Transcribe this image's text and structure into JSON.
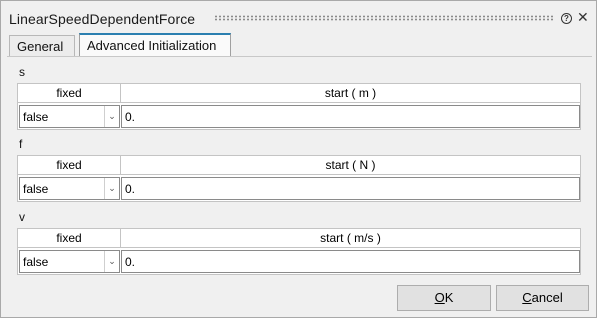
{
  "window": {
    "title": "LinearSpeedDependentForce",
    "help_glyph": "?",
    "close_glyph": "✕"
  },
  "tabs": [
    {
      "label": "General",
      "active": false
    },
    {
      "label": "Advanced Initialization",
      "active": true
    }
  ],
  "sections": [
    {
      "label": "s",
      "fixed_header": "fixed",
      "start_header": "start ( m )",
      "fixed_value": "false",
      "start_value": "0."
    },
    {
      "label": "f",
      "fixed_header": "fixed",
      "start_header": "start ( N )",
      "fixed_value": "false",
      "start_value": "0."
    },
    {
      "label": "v",
      "fixed_header": "fixed",
      "start_header": "start ( m/s )",
      "fixed_value": "false",
      "start_value": "0."
    }
  ],
  "buttons": {
    "ok_mnemonic": "O",
    "ok_rest": "K",
    "cancel_mnemonic": "C",
    "cancel_rest": "ancel"
  },
  "colors": {
    "active_tab_accent": "#2a7fb0",
    "dialog_bg": "#f0f0f0"
  }
}
